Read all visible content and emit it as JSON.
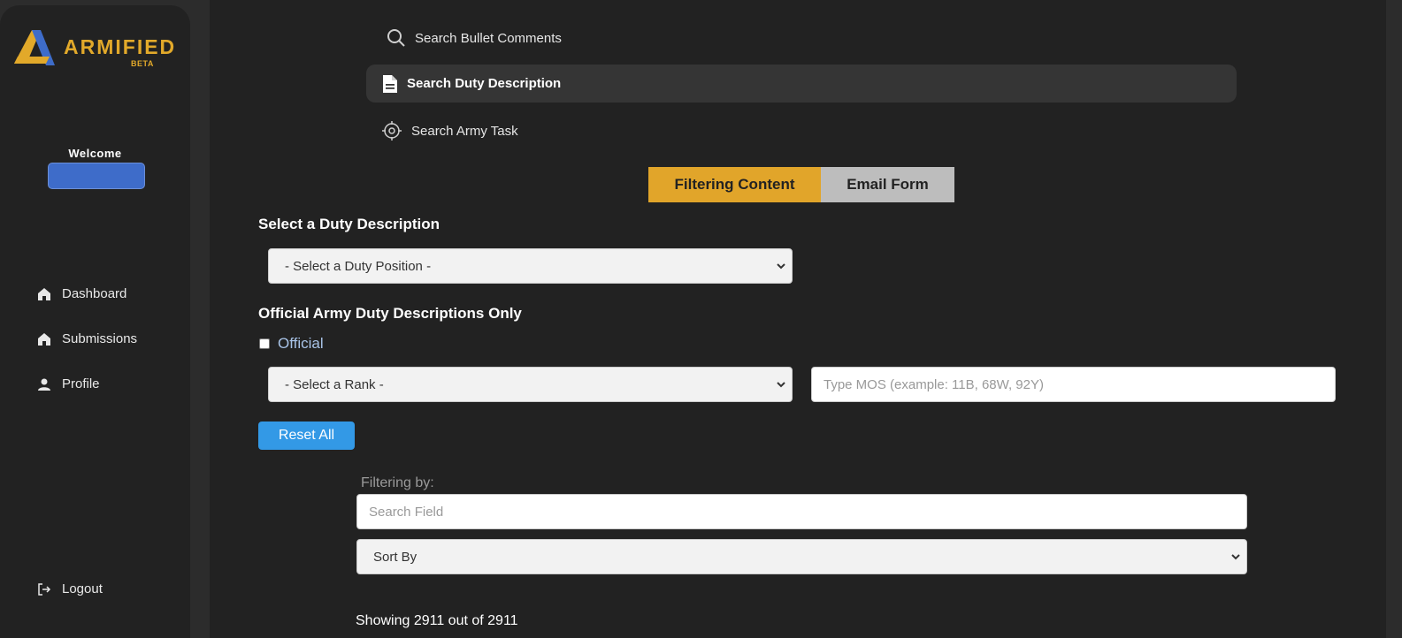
{
  "brand": {
    "name": "ARMIFIED",
    "badge": "BETA",
    "gold": "#e2a92a",
    "blue": "#3e6cc9"
  },
  "sidebar": {
    "welcome": "Welcome",
    "items": [
      {
        "label": "Dashboard",
        "icon": "home-icon"
      },
      {
        "label": "Submissions",
        "icon": "home-icon"
      },
      {
        "label": "Profile",
        "icon": "user-icon"
      }
    ],
    "logout": {
      "label": "Logout",
      "icon": "logout-icon"
    }
  },
  "search_tabs": [
    {
      "label": "Search Bullet Comments",
      "icon": "search-icon"
    },
    {
      "label": "Search Duty Description",
      "icon": "document-icon",
      "active": true
    },
    {
      "label": "Search Army Task",
      "icon": "target-icon"
    }
  ],
  "toggle": {
    "filtering": "Filtering Content",
    "email": "Email Form"
  },
  "form": {
    "duty_heading": "Select a Duty Description",
    "duty_select": "- Select a Duty Position -",
    "official_heading": "Official Army Duty Descriptions Only",
    "official_label": "Official",
    "rank_select": "- Select a Rank -",
    "mos_placeholder": "Type MOS (example: 11B, 68W, 92Y)",
    "reset": "Reset All"
  },
  "results": {
    "filtering_by": "Filtering by:",
    "search_placeholder": "Search Field",
    "sort_by": "Sort By",
    "showing": "Showing 2911 out of 2911"
  }
}
